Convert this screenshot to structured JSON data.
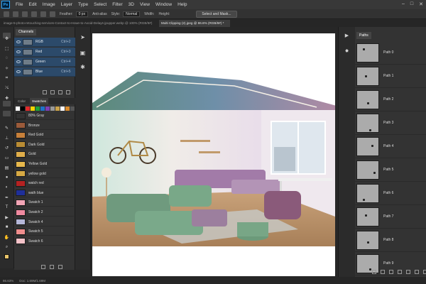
{
  "menubar": {
    "logo": "Ps",
    "items": [
      "File",
      "Edit",
      "Image",
      "Layer",
      "Type",
      "Select",
      "Filter",
      "3D",
      "View",
      "Window",
      "Help"
    ]
  },
  "options": {
    "feather_label": "Feather:",
    "feather_value": "0 px",
    "antialias_label": "Anti-alias",
    "style_label": "Style:",
    "style_value": "Normal",
    "width_label": "Width:",
    "height_label": "Height:",
    "select_mask_button": "Select and Mask..."
  },
  "tabs": {
    "inactive": "image-5-photo-retouching-services-Contact-to-Howe-to-Avoid-Delays-jpupper.webp @ 100% (RGB/8#)",
    "active": "Multi Clipping (2).jpeg @ 86.6% (RGB/8#) *"
  },
  "channels": {
    "tab": "Channels",
    "rows": [
      {
        "name": "RGB",
        "shortcut": "Ctrl+2"
      },
      {
        "name": "Red",
        "shortcut": "Ctrl+3"
      },
      {
        "name": "Green",
        "shortcut": "Ctrl+4"
      },
      {
        "name": "Blue",
        "shortcut": "Ctrl+5"
      }
    ]
  },
  "swatches": {
    "tabs": [
      "Color",
      "Swatches"
    ],
    "strip_colors": [
      "#ffffff",
      "#000000",
      "#e02a2a",
      "#f5d400",
      "#1fa23a",
      "#1e73c8",
      "#7d3fb5",
      "#999999",
      "#c9a24a",
      "#ffffff",
      "#d98a2b",
      "#555555",
      "#e07e7e",
      "#88c0e8",
      "#f0f0f0"
    ],
    "rows": [
      {
        "name": "80% Gray",
        "color": "#333333"
      },
      {
        "name": "Bronze",
        "color": "#9a5a3a"
      },
      {
        "name": "Red Gold",
        "color": "#c7803a"
      },
      {
        "name": "Dark Gold",
        "color": "#b98c34"
      },
      {
        "name": "Gold",
        "color": "#e0ae4a"
      },
      {
        "name": "Yellow Gold",
        "color": "#e7b84c"
      },
      {
        "name": "yellow gold",
        "color": "#d7aa44"
      },
      {
        "name": "watch red",
        "color": "#b52222"
      },
      {
        "name": "wath blue",
        "color": "#1f2f9a"
      },
      {
        "name": "Swatch 1",
        "color": "#f2a5b6"
      },
      {
        "name": "Swatch 2",
        "color": "#f08aa0"
      },
      {
        "name": "Swatch 4",
        "color": "#b5b7d8"
      },
      {
        "name": "Swatch 5",
        "color": "#ef8d8d"
      },
      {
        "name": "Swatch 6",
        "color": "#f3c2c8"
      }
    ]
  },
  "paths": {
    "tab": "Paths",
    "rows": [
      "Path 0",
      "Path 1",
      "Path 2",
      "Path 3",
      "Path 4",
      "Path 5",
      "Path 6",
      "Path 7",
      "Path 8",
      "Path 9"
    ]
  },
  "status": {
    "zoom": "86.63%",
    "doc": "Doc: 1.69M/1.69M"
  }
}
